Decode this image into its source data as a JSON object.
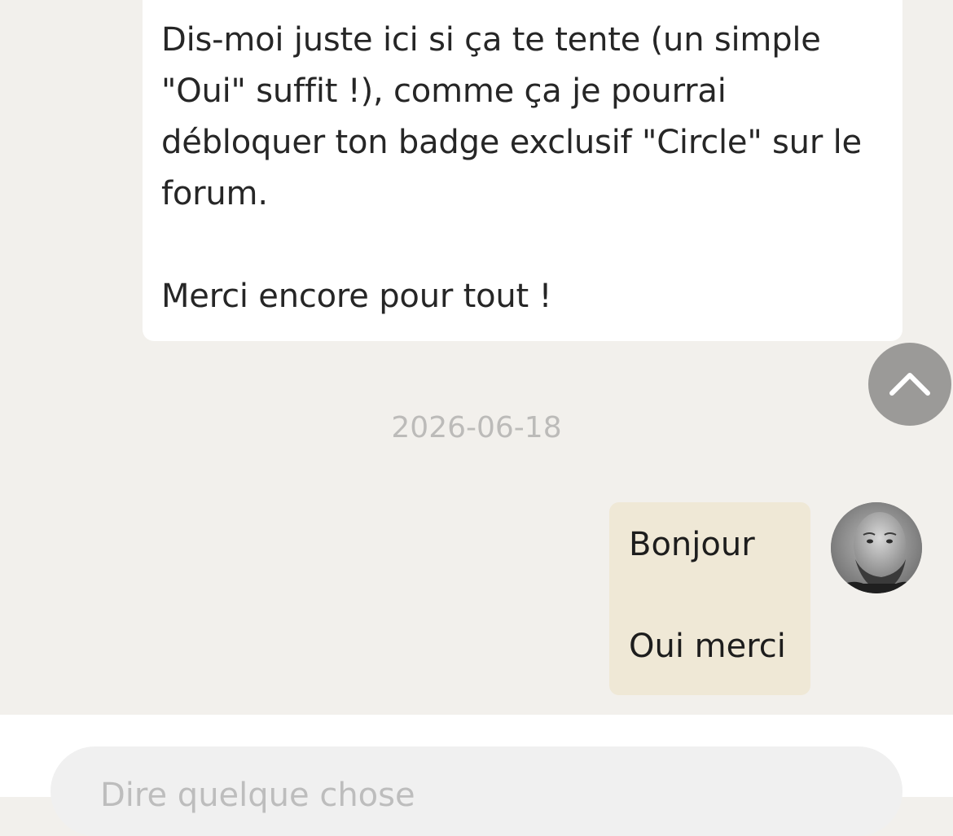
{
  "thread": {
    "incoming": {
      "lines": [
        "Dis-moi juste ici si ça te tente (un simple",
        "\"Oui\" suffit !), comme ça je pourrai",
        "débloquer ton badge exclusif \"Circle\" sur le",
        "forum.",
        "Merci encore pour tout !"
      ]
    },
    "date_separator": "2026-06-18",
    "outgoing": {
      "lines": [
        "Bonjour",
        "Oui merci"
      ]
    }
  },
  "composer": {
    "placeholder": "Dire quelque chose"
  },
  "icons": {
    "scroll_top": "chevron-up-icon",
    "avatar": "user-avatar"
  },
  "colors": {
    "background": "#f2f0ec",
    "incoming_bubble": "#ffffff",
    "outgoing_bubble": "#efe8d6",
    "scroll_button": "#9b9a98",
    "date_text": "#bcbbb9"
  }
}
